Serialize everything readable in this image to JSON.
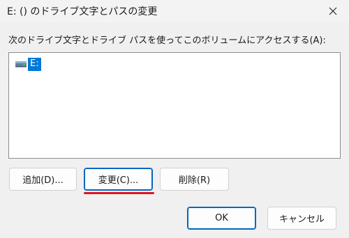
{
  "window": {
    "title": "E: () のドライブ文字とパスの変更"
  },
  "prompt": "次のドライブ文字とドライブ パスを使ってこのボリュームにアクセスする(A):",
  "listbox": {
    "items": [
      {
        "label": "E:",
        "icon": "drive-icon",
        "selected": true
      }
    ]
  },
  "buttons": {
    "add": "追加(D)...",
    "change": "変更(C)...",
    "remove": "削除(R)",
    "ok": "OK",
    "cancel": "キャンセル"
  },
  "colors": {
    "selection": "#0078d7",
    "accent_border": "#0067c0",
    "annotation_underline": "#e0141e"
  }
}
